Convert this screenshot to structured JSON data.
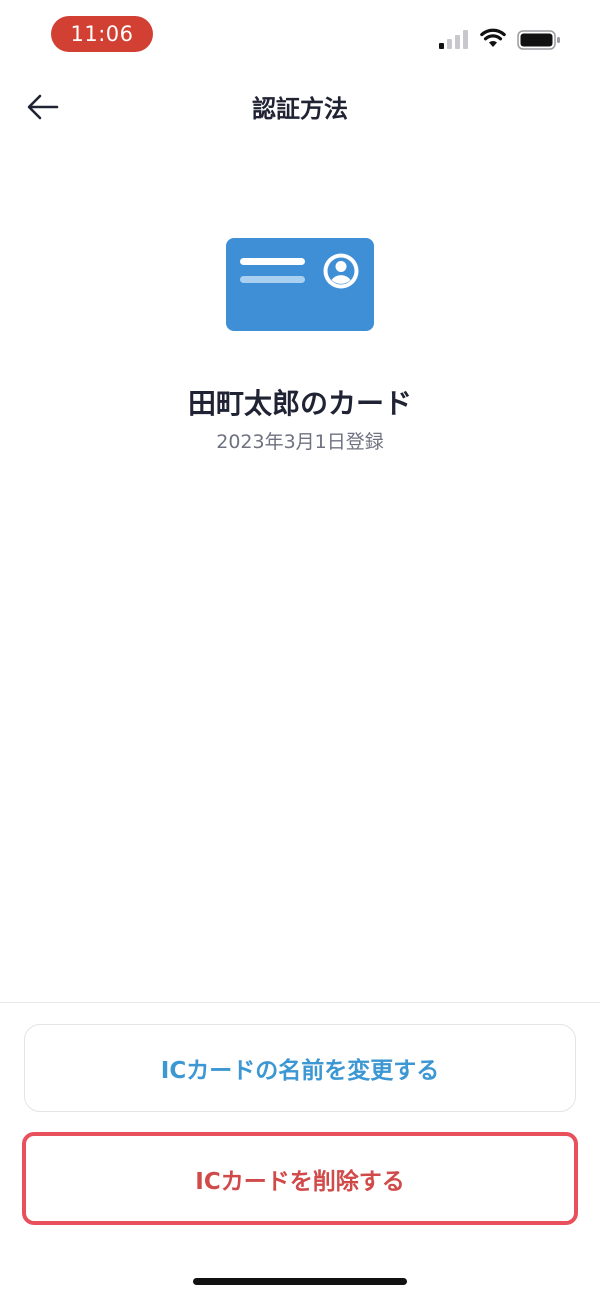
{
  "status_bar": {
    "time": "11:06",
    "signal_icon": "cellular-signal-icon",
    "wifi_icon": "wifi-icon",
    "battery_icon": "battery-icon"
  },
  "nav": {
    "title": "認証方法",
    "back_icon": "arrow-left-icon"
  },
  "card": {
    "icon": "id-card-icon",
    "name": "田町太郎のカード",
    "registered": "2023年3月1日登録",
    "card_color": "#3f8fd7"
  },
  "actions": {
    "rename_label": "ICカードの名前を変更する",
    "delete_label": "ICカードを削除する"
  },
  "colors": {
    "time_pill": "#d23f33",
    "rename_text": "#3c97d3",
    "delete_text": "#d14a4a",
    "delete_border": "#e8505c"
  }
}
